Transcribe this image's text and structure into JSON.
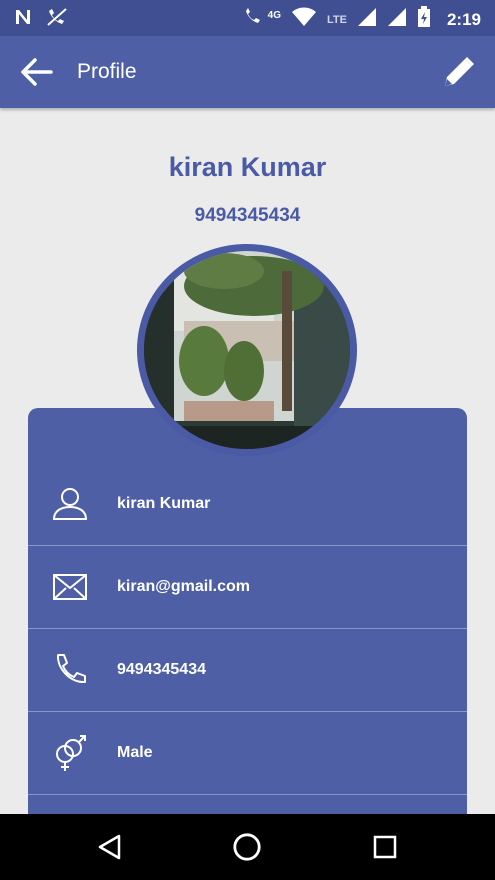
{
  "status_bar": {
    "network_label": "4G",
    "lte_label": "LTE",
    "time": "2:19"
  },
  "app_bar": {
    "title": "Profile",
    "back_icon": "arrow-back-icon",
    "edit_icon": "pencil-icon"
  },
  "profile": {
    "name": "kiran Kumar",
    "phone": "9494345434"
  },
  "info_rows": [
    {
      "icon": "person-icon",
      "value": "kiran Kumar"
    },
    {
      "icon": "envelope-icon",
      "value": "kiran@gmail.com"
    },
    {
      "icon": "phone-icon",
      "value": "9494345434"
    },
    {
      "icon": "gender-icon",
      "value": "Male"
    }
  ],
  "colors": {
    "primary": "#4e5fa5",
    "primary_dark": "#3f4f91",
    "accent_text": "#4a5aa5",
    "background": "#ebebeb"
  }
}
